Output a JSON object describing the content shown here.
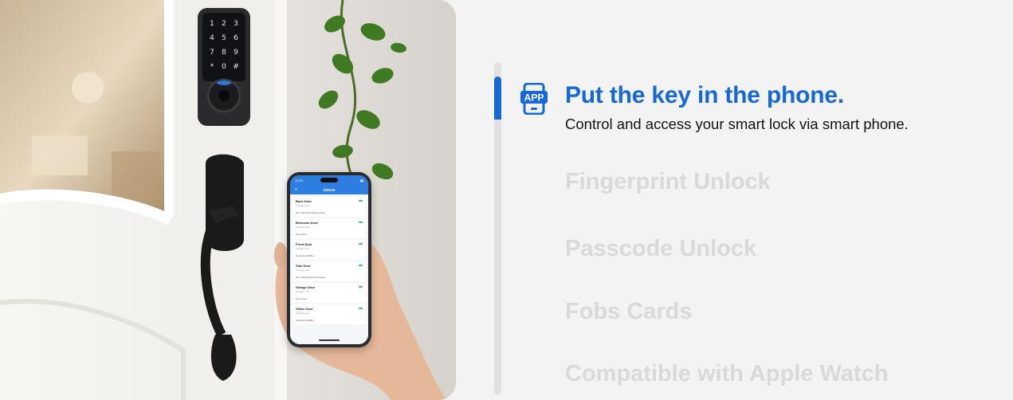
{
  "features": {
    "active": {
      "icon": "app-phone-icon",
      "icon_text": "APP",
      "title": "Put the key in the phone.",
      "description": "Control and access your smart lock via smart phone."
    },
    "items": [
      {
        "label": "Fingerprint Unlock"
      },
      {
        "label": "Passcode Unlock"
      },
      {
        "label": "Fobs Cards"
      },
      {
        "label": "Compatible with Apple Watch"
      }
    ]
  },
  "phone_app": {
    "time": "12:03",
    "app_title": "SSlock",
    "locks": [
      {
        "name": "Back Door",
        "sub": "Schlage lock",
        "status": "No connection/online status"
      },
      {
        "name": "Bedroom Door",
        "sub": "Schlage lock",
        "status": "No access"
      },
      {
        "name": "Front Door",
        "sub": "Schlage lock",
        "status": "No access/offline"
      },
      {
        "name": "Side Door",
        "sub": "Schlage lock",
        "status": "No connection/online status"
      },
      {
        "name": "Garage Door",
        "sub": "Schlage lock",
        "status": "No access"
      },
      {
        "name": "Office Door",
        "sub": "Schlage lock",
        "status": "No access/offline"
      }
    ]
  },
  "keypad": {
    "keys": [
      "1",
      "2",
      "3",
      "4",
      "5",
      "6",
      "7",
      "8",
      "9",
      "*",
      "0",
      "#"
    ]
  },
  "colors": {
    "accent": "#1668d8",
    "inactive_text": "#d9d9db",
    "background": "#f3f3f4",
    "body_text": "#141414"
  }
}
